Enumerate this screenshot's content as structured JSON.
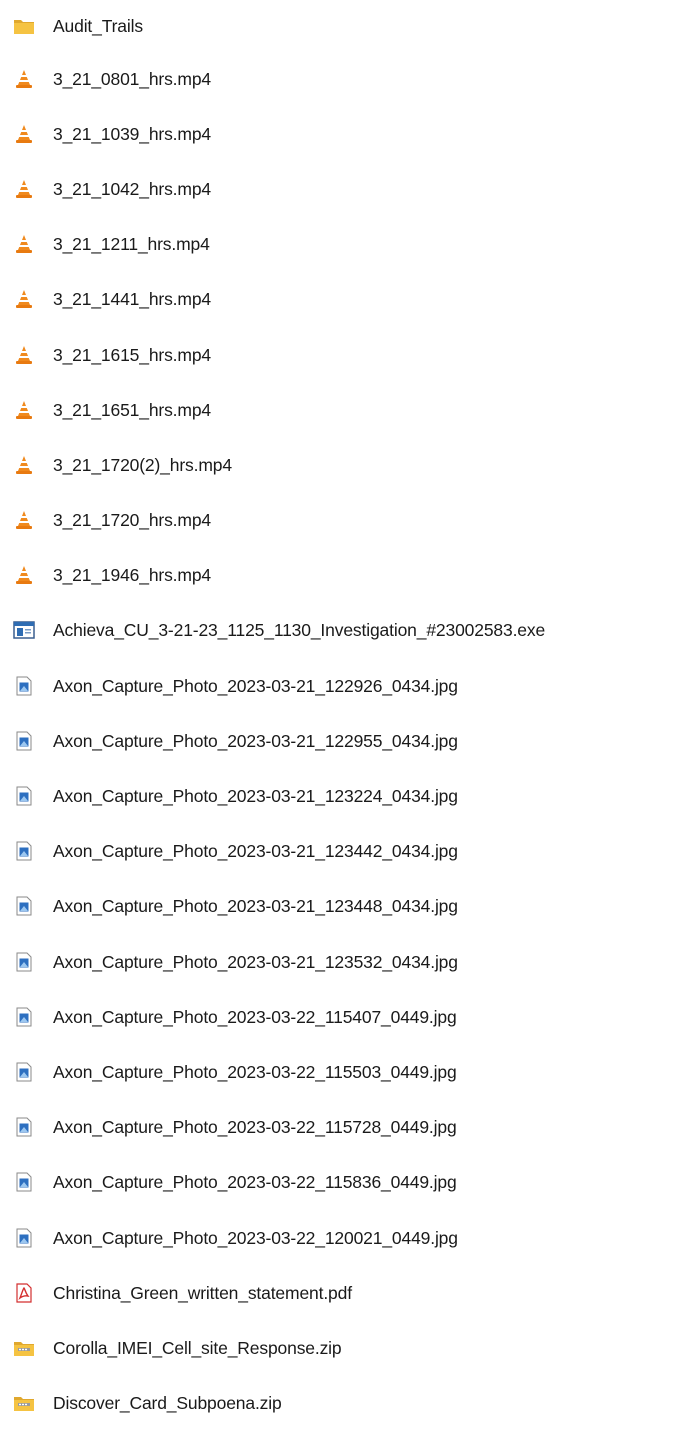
{
  "files": [
    {
      "name": "Audit_Trails",
      "icon": "folder-icon"
    },
    {
      "name": "3_21_0801_hrs.mp4",
      "icon": "vlc-cone-icon"
    },
    {
      "name": "3_21_1039_hrs.mp4",
      "icon": "vlc-cone-icon"
    },
    {
      "name": "3_21_1042_hrs.mp4",
      "icon": "vlc-cone-icon"
    },
    {
      "name": "3_21_1211_hrs.mp4",
      "icon": "vlc-cone-icon"
    },
    {
      "name": "3_21_1441_hrs.mp4",
      "icon": "vlc-cone-icon"
    },
    {
      "name": "3_21_1615_hrs.mp4",
      "icon": "vlc-cone-icon"
    },
    {
      "name": "3_21_1651_hrs.mp4",
      "icon": "vlc-cone-icon"
    },
    {
      "name": "3_21_1720(2)_hrs.mp4",
      "icon": "vlc-cone-icon"
    },
    {
      "name": "3_21_1720_hrs.mp4",
      "icon": "vlc-cone-icon"
    },
    {
      "name": "3_21_1946_hrs.mp4",
      "icon": "vlc-cone-icon"
    },
    {
      "name": "Achieva_CU_3-21-23_1125_1130_Investigation_#23002583.exe",
      "icon": "executable-icon"
    },
    {
      "name": "Axon_Capture_Photo_2023-03-21_122926_0434.jpg",
      "icon": "image-file-icon"
    },
    {
      "name": "Axon_Capture_Photo_2023-03-21_122955_0434.jpg",
      "icon": "image-file-icon"
    },
    {
      "name": "Axon_Capture_Photo_2023-03-21_123224_0434.jpg",
      "icon": "image-file-icon"
    },
    {
      "name": "Axon_Capture_Photo_2023-03-21_123442_0434.jpg",
      "icon": "image-file-icon"
    },
    {
      "name": "Axon_Capture_Photo_2023-03-21_123448_0434.jpg",
      "icon": "image-file-icon"
    },
    {
      "name": "Axon_Capture_Photo_2023-03-21_123532_0434.jpg",
      "icon": "image-file-icon"
    },
    {
      "name": "Axon_Capture_Photo_2023-03-22_115407_0449.jpg",
      "icon": "image-file-icon"
    },
    {
      "name": "Axon_Capture_Photo_2023-03-22_115503_0449.jpg",
      "icon": "image-file-icon"
    },
    {
      "name": "Axon_Capture_Photo_2023-03-22_115728_0449.jpg",
      "icon": "image-file-icon"
    },
    {
      "name": "Axon_Capture_Photo_2023-03-22_115836_0449.jpg",
      "icon": "image-file-icon"
    },
    {
      "name": "Axon_Capture_Photo_2023-03-22_120021_0449.jpg",
      "icon": "image-file-icon"
    },
    {
      "name": "Christina_Green_written_statement.pdf",
      "icon": "pdf-icon"
    },
    {
      "name": "Corolla_IMEI_Cell_site_Response.zip",
      "icon": "zip-folder-icon"
    },
    {
      "name": "Discover_Card_Subpoena.zip",
      "icon": "zip-folder-icon"
    }
  ],
  "colors": {
    "folder": "#f5c342",
    "vlc_orange": "#f08a1e",
    "pdf_red": "#d32f2f",
    "image_blue": "#2d6fc0",
    "text": "#1a1a1a"
  }
}
